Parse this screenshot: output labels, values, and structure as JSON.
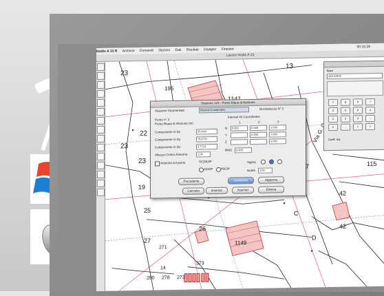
{
  "menubar": {
    "items": [
      "Nodis A 33 R",
      "Archivio",
      "Comandi",
      "Opzioni",
      "Dati",
      "Risultati",
      "Disegno",
      "Finestre"
    ],
    "clock": "00:10.28"
  },
  "window": {
    "title": "Lavoro Nodis A 33"
  },
  "map": {
    "labels": [
      "23",
      "13",
      "195",
      "1141",
      "17",
      "23",
      "23",
      "22",
      "19",
      "115",
      "42",
      "25",
      "26",
      "42",
      "C",
      "D",
      "1149",
      "27",
      "271",
      "373",
      "280",
      "278",
      "273",
      "14",
      "Via G. Garibaldi"
    ]
  },
  "dialog": {
    "title": "Stazione 125 - Punto Riqua di Bastione",
    "tab_left": "Stazione Strumentale",
    "dropdown": "Internal Coordinates",
    "tab_right": "Nord/altezza N° 2",
    "section_left": "Punto n° 3",
    "section_left_sub": "Punto Riqua di rifesione (m)",
    "section_right": "Internal 40 Coordinates",
    "rows": [
      {
        "label": "Componente in Dx",
        "value": "95,4x4r"
      },
      {
        "label": "Componente in Dy",
        "value": "76,0747"
      },
      {
        "label": "Componente in Dz",
        "value": "3,7724"
      },
      {
        "label": "Altezza Centro Antenna",
        "value": "1,94"
      }
    ],
    "matrix_headers": [
      "1",
      "2",
      "3"
    ],
    "matrix_rows": [
      {
        "label": "N",
        "values": [
          "0.001",
          "0.028",
          "1.000"
        ]
      },
      {
        "label": "Y",
        "values": [
          "",
          "0.000",
          "7.000"
        ]
      },
      {
        "label": "Z",
        "values": [
          "",
          "",
          "1.000"
        ]
      }
    ],
    "rms_label": "RMS",
    "rms_value": "0.000",
    "sigma_label": "Sigma",
    "sigma_value": "1.00",
    "checkbox_label": "Antenna sul punto",
    "radio_label": "SIGNOIP",
    "radio_options": [
      "GDOP",
      "PDOP"
    ],
    "misc_label": "Noteb",
    "buttons": {
      "preview": "Precedente",
      "confirm": "Conferma",
      "cancel": "Cancella",
      "insert": "Inserisci",
      "delete": "Elimina",
      "aggiorna": "Aggiorna"
    }
  },
  "calculator": {
    "title": "Base",
    "display": "123.47872",
    "keys": [
      "7",
      "8",
      "9",
      "/",
      "4",
      "5",
      "6",
      "x",
      "1",
      "2",
      "3",
      "-",
      "0",
      ".",
      "=",
      "+"
    ],
    "footer": "Coeff. ma."
  }
}
